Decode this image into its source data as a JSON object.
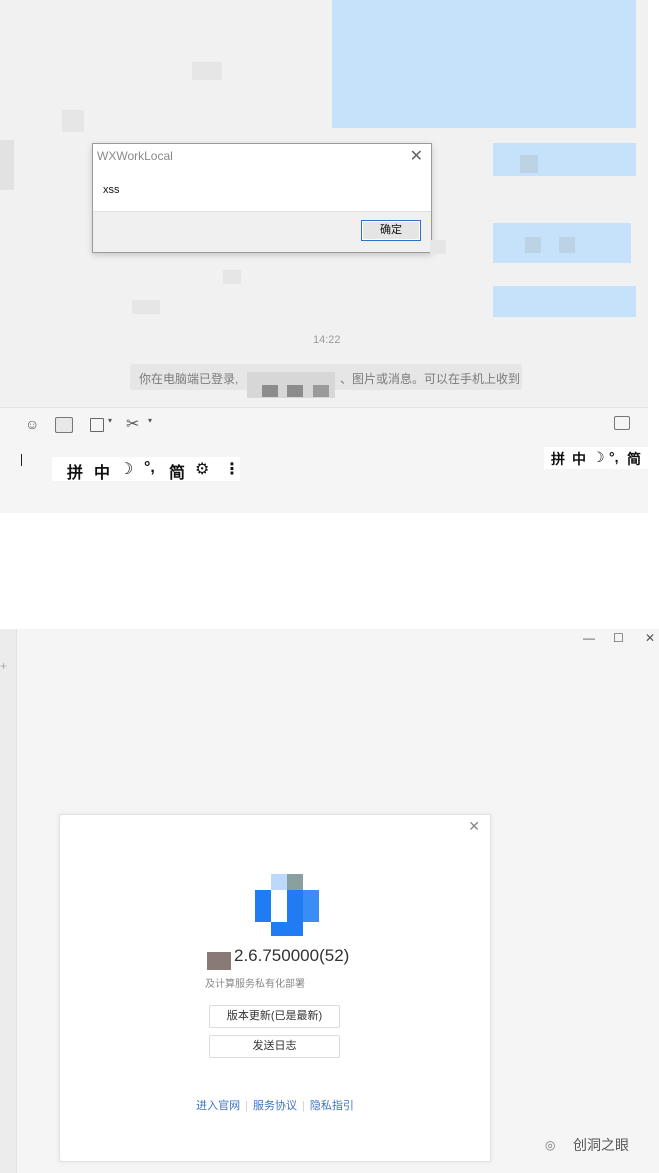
{
  "alert": {
    "title": "WXWorkLocal",
    "message": "xss",
    "ok_label": "确定",
    "close_glyph": "✕"
  },
  "chat": {
    "timestamp": "14:22",
    "system_message_left": "你在电脑端已登录,",
    "system_message_right": "、图片或消息。可以在手机上收到"
  },
  "input_toolbar": {
    "icons": [
      "emoji-icon",
      "screenshot-icon",
      "folder-icon",
      "scissors-icon",
      "history-icon"
    ]
  },
  "ime_bar": {
    "items": [
      "拼",
      "中",
      "☽",
      "°,",
      "简",
      "⚙",
      "⋮"
    ],
    "small_items": [
      "拼",
      "中",
      "☽",
      "°,",
      "简"
    ]
  },
  "window_controls": {
    "minimize": "—",
    "maximize": "☐",
    "close": "✕"
  },
  "about": {
    "close_glyph": "✕",
    "version": "2.6.750000(52)",
    "description": "及计算服务私有化部署",
    "update_button": "版本更新(已是最新)",
    "send_log_button": "发送日志",
    "links": [
      "进入官网",
      "服务协议",
      "隐私指引"
    ],
    "logo_colors": [
      "#1f7cf3",
      "#3a8df5",
      "#8aa0a0",
      "#bcd8fb"
    ]
  },
  "watermark": {
    "text": "创洞之眼"
  }
}
